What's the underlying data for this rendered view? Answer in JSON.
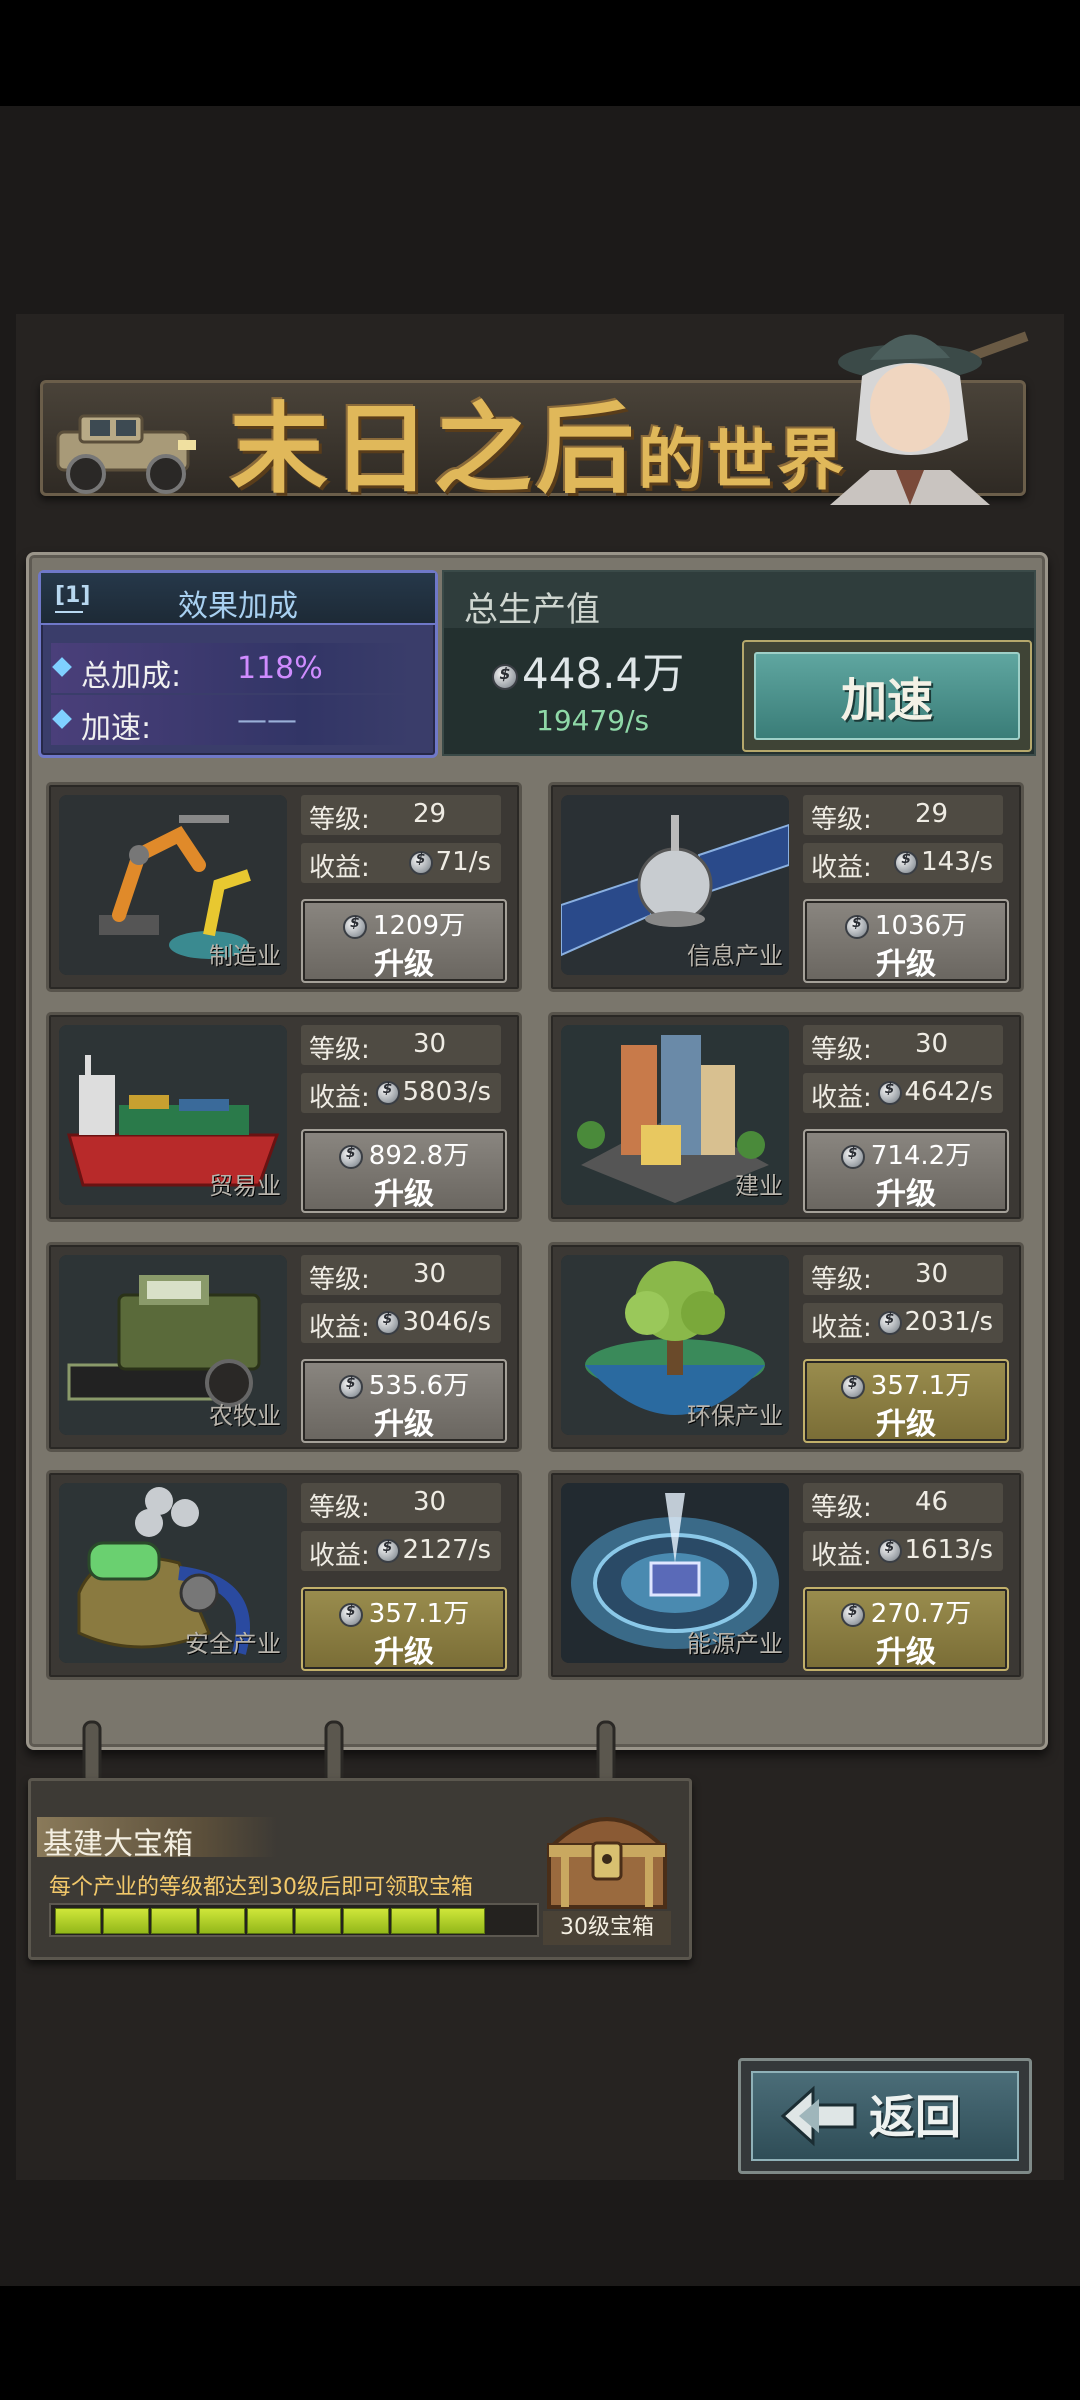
{
  "banner": {
    "title_main": "末日之后",
    "title_sub": "的世界"
  },
  "effect": {
    "icon_label": "[1]",
    "title": "效果加成",
    "total_label": "总加成:",
    "total_value": "118%",
    "speed_label": "加速:",
    "speed_value": "——"
  },
  "output": {
    "title": "总生产值",
    "value": "448.4万",
    "rate": "19479/s",
    "speed_button": "加速"
  },
  "industries": [
    {
      "name": "制造业",
      "level_label": "等级:",
      "level": "29",
      "income_label": "收益:",
      "income": "71/s",
      "cost": "1209万",
      "upgrade": "升级",
      "button_style": "gray"
    },
    {
      "name": "信息产业",
      "level_label": "等级:",
      "level": "29",
      "income_label": "收益:",
      "income": "143/s",
      "cost": "1036万",
      "upgrade": "升级",
      "button_style": "gray"
    },
    {
      "name": "贸易业",
      "level_label": "等级:",
      "level": "30",
      "income_label": "收益:",
      "income": "5803/s",
      "cost": "892.8万",
      "upgrade": "升级",
      "button_style": "gray"
    },
    {
      "name": "建业",
      "level_label": "等级:",
      "level": "30",
      "income_label": "收益:",
      "income": "4642/s",
      "cost": "714.2万",
      "upgrade": "升级",
      "button_style": "gray"
    },
    {
      "name": "农牧业",
      "level_label": "等级:",
      "level": "30",
      "income_label": "收益:",
      "income": "3046/s",
      "cost": "535.6万",
      "upgrade": "升级",
      "button_style": "gray"
    },
    {
      "name": "环保产业",
      "level_label": "等级:",
      "level": "30",
      "income_label": "收益:",
      "income": "2031/s",
      "cost": "357.1万",
      "upgrade": "升级",
      "button_style": "gold"
    },
    {
      "name": "安全产业",
      "level_label": "等级:",
      "level": "30",
      "income_label": "收益:",
      "income": "2127/s",
      "cost": "357.1万",
      "upgrade": "升级",
      "button_style": "gold"
    },
    {
      "name": "能源产业",
      "level_label": "等级:",
      "level": "46",
      "income_label": "收益:",
      "income": "1613/s",
      "cost": "270.7万",
      "upgrade": "升级",
      "button_style": "gold"
    }
  ],
  "chest": {
    "title": "基建大宝箱",
    "description": "每个产业的等级都达到30级后即可领取宝箱",
    "progress_filled": 9,
    "progress_total": 10,
    "caption": "30级宝箱"
  },
  "back_button": "返回",
  "colors": {
    "panel": "#7a766c",
    "effect_accent": "#6f78c8",
    "bonus_value": "#d08cff",
    "rate_green": "#8fd9a8",
    "speed_button": "#3a7d78",
    "upgrade_gray": "#6a6660",
    "upgrade_gold": "#7a6d36",
    "progress": "#b8d82a"
  }
}
